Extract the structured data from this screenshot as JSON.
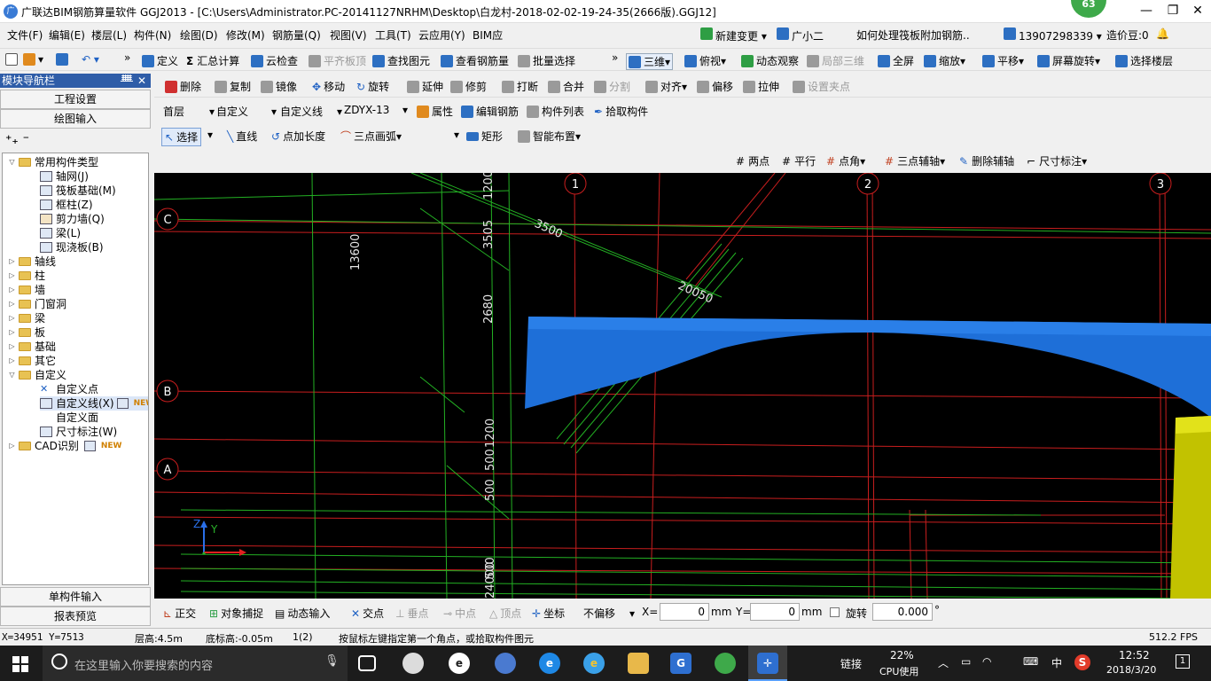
{
  "window": {
    "title": "广联达BIM钢筋算量软件 GGJ2013 - [C:\\Users\\Administrator.PC-20141127NRHM\\Desktop\\白龙村-2018-02-02-19-24-35(2666版).GGJ12]",
    "badge": "63",
    "minimize": "—",
    "restore": "❐",
    "close": "✕"
  },
  "menu": {
    "items": [
      "文件(F)",
      "编辑(E)",
      "楼层(L)",
      "构件(N)",
      "绘图(D)",
      "修改(M)",
      "钢筋量(Q)",
      "视图(V)",
      "工具(T)",
      "云应用(Y)",
      "BIM应"
    ],
    "new_change": "新建变更",
    "assistant": "广小二",
    "question": "如何处理筏板附加钢筋..",
    "phone": "13907298339",
    "coins": "造价豆:0"
  },
  "toolbar1": {
    "define": "定义",
    "sum_calc": "汇总计算",
    "cloud_check": "云检查",
    "level_slab": "平齐板顶",
    "find_element": "查找图元",
    "view_rebar": "查看钢筋量",
    "batch_select": "批量选择",
    "three_d": "三维",
    "top_view": "俯视",
    "dynamic_view": "动态观察",
    "local_3d": "局部三维",
    "fullscreen": "全屏",
    "zoom": "缩放",
    "pan": "平移",
    "screen_rotate": "屏幕旋转",
    "select_floor": "选择楼层"
  },
  "nav": {
    "title": "模块导航栏",
    "project_settings": "工程设置",
    "drawing_input": "绘图输入",
    "single_input": "单构件输入",
    "report_preview": "报表预览"
  },
  "tree": {
    "common_types": "常用构件类型",
    "common_items": [
      "轴网(J)",
      "筏板基础(M)",
      "框柱(Z)",
      "剪力墙(Q)",
      "梁(L)",
      "现浇板(B)"
    ],
    "groups": [
      "轴线",
      "柱",
      "墙",
      "门窗洞",
      "梁",
      "板",
      "基础",
      "其它"
    ],
    "custom": "自定义",
    "custom_items": [
      "自定义点",
      "自定义线(X)",
      "自定义面",
      "尺寸标注(W)"
    ],
    "cad": "CAD识别",
    "new_tag": "NEW"
  },
  "edit_toolbar": {
    "delete": "删除",
    "copy": "复制",
    "mirror": "镜像",
    "move": "移动",
    "rotate": "旋转",
    "extend": "延伸",
    "trim": "修剪",
    "break": "打断",
    "merge": "合并",
    "split": "分割",
    "align": "对齐",
    "offset": "偏移",
    "stretch": "拉伸",
    "set_grip": "设置夹点"
  },
  "prop_toolbar": {
    "floor": "首层",
    "category": "自定义",
    "type": "自定义线",
    "name": "ZDYX-13",
    "properties": "属性",
    "edit_rebar": "编辑钢筋",
    "element_list": "构件列表",
    "pick_element": "拾取构件"
  },
  "draw_toolbar": {
    "select": "选择",
    "line": "直线",
    "add_length": "点加长度",
    "arc3": "三点画弧",
    "rect": "矩形",
    "smart_layout": "智能布置"
  },
  "aux_toolbar": {
    "two_points": "两点",
    "parallel": "平行",
    "point_angle": "点角",
    "three_point_axis": "三点辅轴",
    "delete_axis": "删除辅轴",
    "dimension": "尺寸标注"
  },
  "canvas": {
    "axis_labels": [
      "C",
      "B",
      "A",
      "1",
      "2",
      "3"
    ],
    "dims": [
      "13600",
      "1200",
      "3505",
      "3500",
      "2680",
      "20050",
      "1200",
      "500",
      "500",
      "500",
      "24000"
    ],
    "ucs_y": "Y",
    "ucs_z": "Z"
  },
  "snap_bar": {
    "ortho": "正交",
    "object_snap": "对象捕捉",
    "dynamic_input": "动态输入",
    "intersection": "交点",
    "perpendicular": "垂点",
    "midpoint": "中点",
    "vertex": "顶点",
    "coordinate": "坐标",
    "offset_mode": "不偏移",
    "x_label": "X=",
    "x_value": "0",
    "y_label": "Y=",
    "y_value": "0",
    "unit": "mm",
    "rotate_label": "旋转",
    "rotate_value": "0.000",
    "degree": "°"
  },
  "status": {
    "coords": "X=34951 Y=7513",
    "floor_height": "层高:4.5m",
    "base_height": "底标高:-0.05m",
    "count": "1(2)",
    "hint": "按鼠标左键指定第一个角点，或拾取构件图元",
    "fps": "512.2 FPS"
  },
  "taskbar": {
    "search_placeholder": "在这里输入你要搜索的内容",
    "link": "链接",
    "cpu_percent": "22%",
    "cpu_label": "CPU使用",
    "ime": "中",
    "time": "12:52",
    "date": "2018/3/20",
    "notifications": "1"
  }
}
